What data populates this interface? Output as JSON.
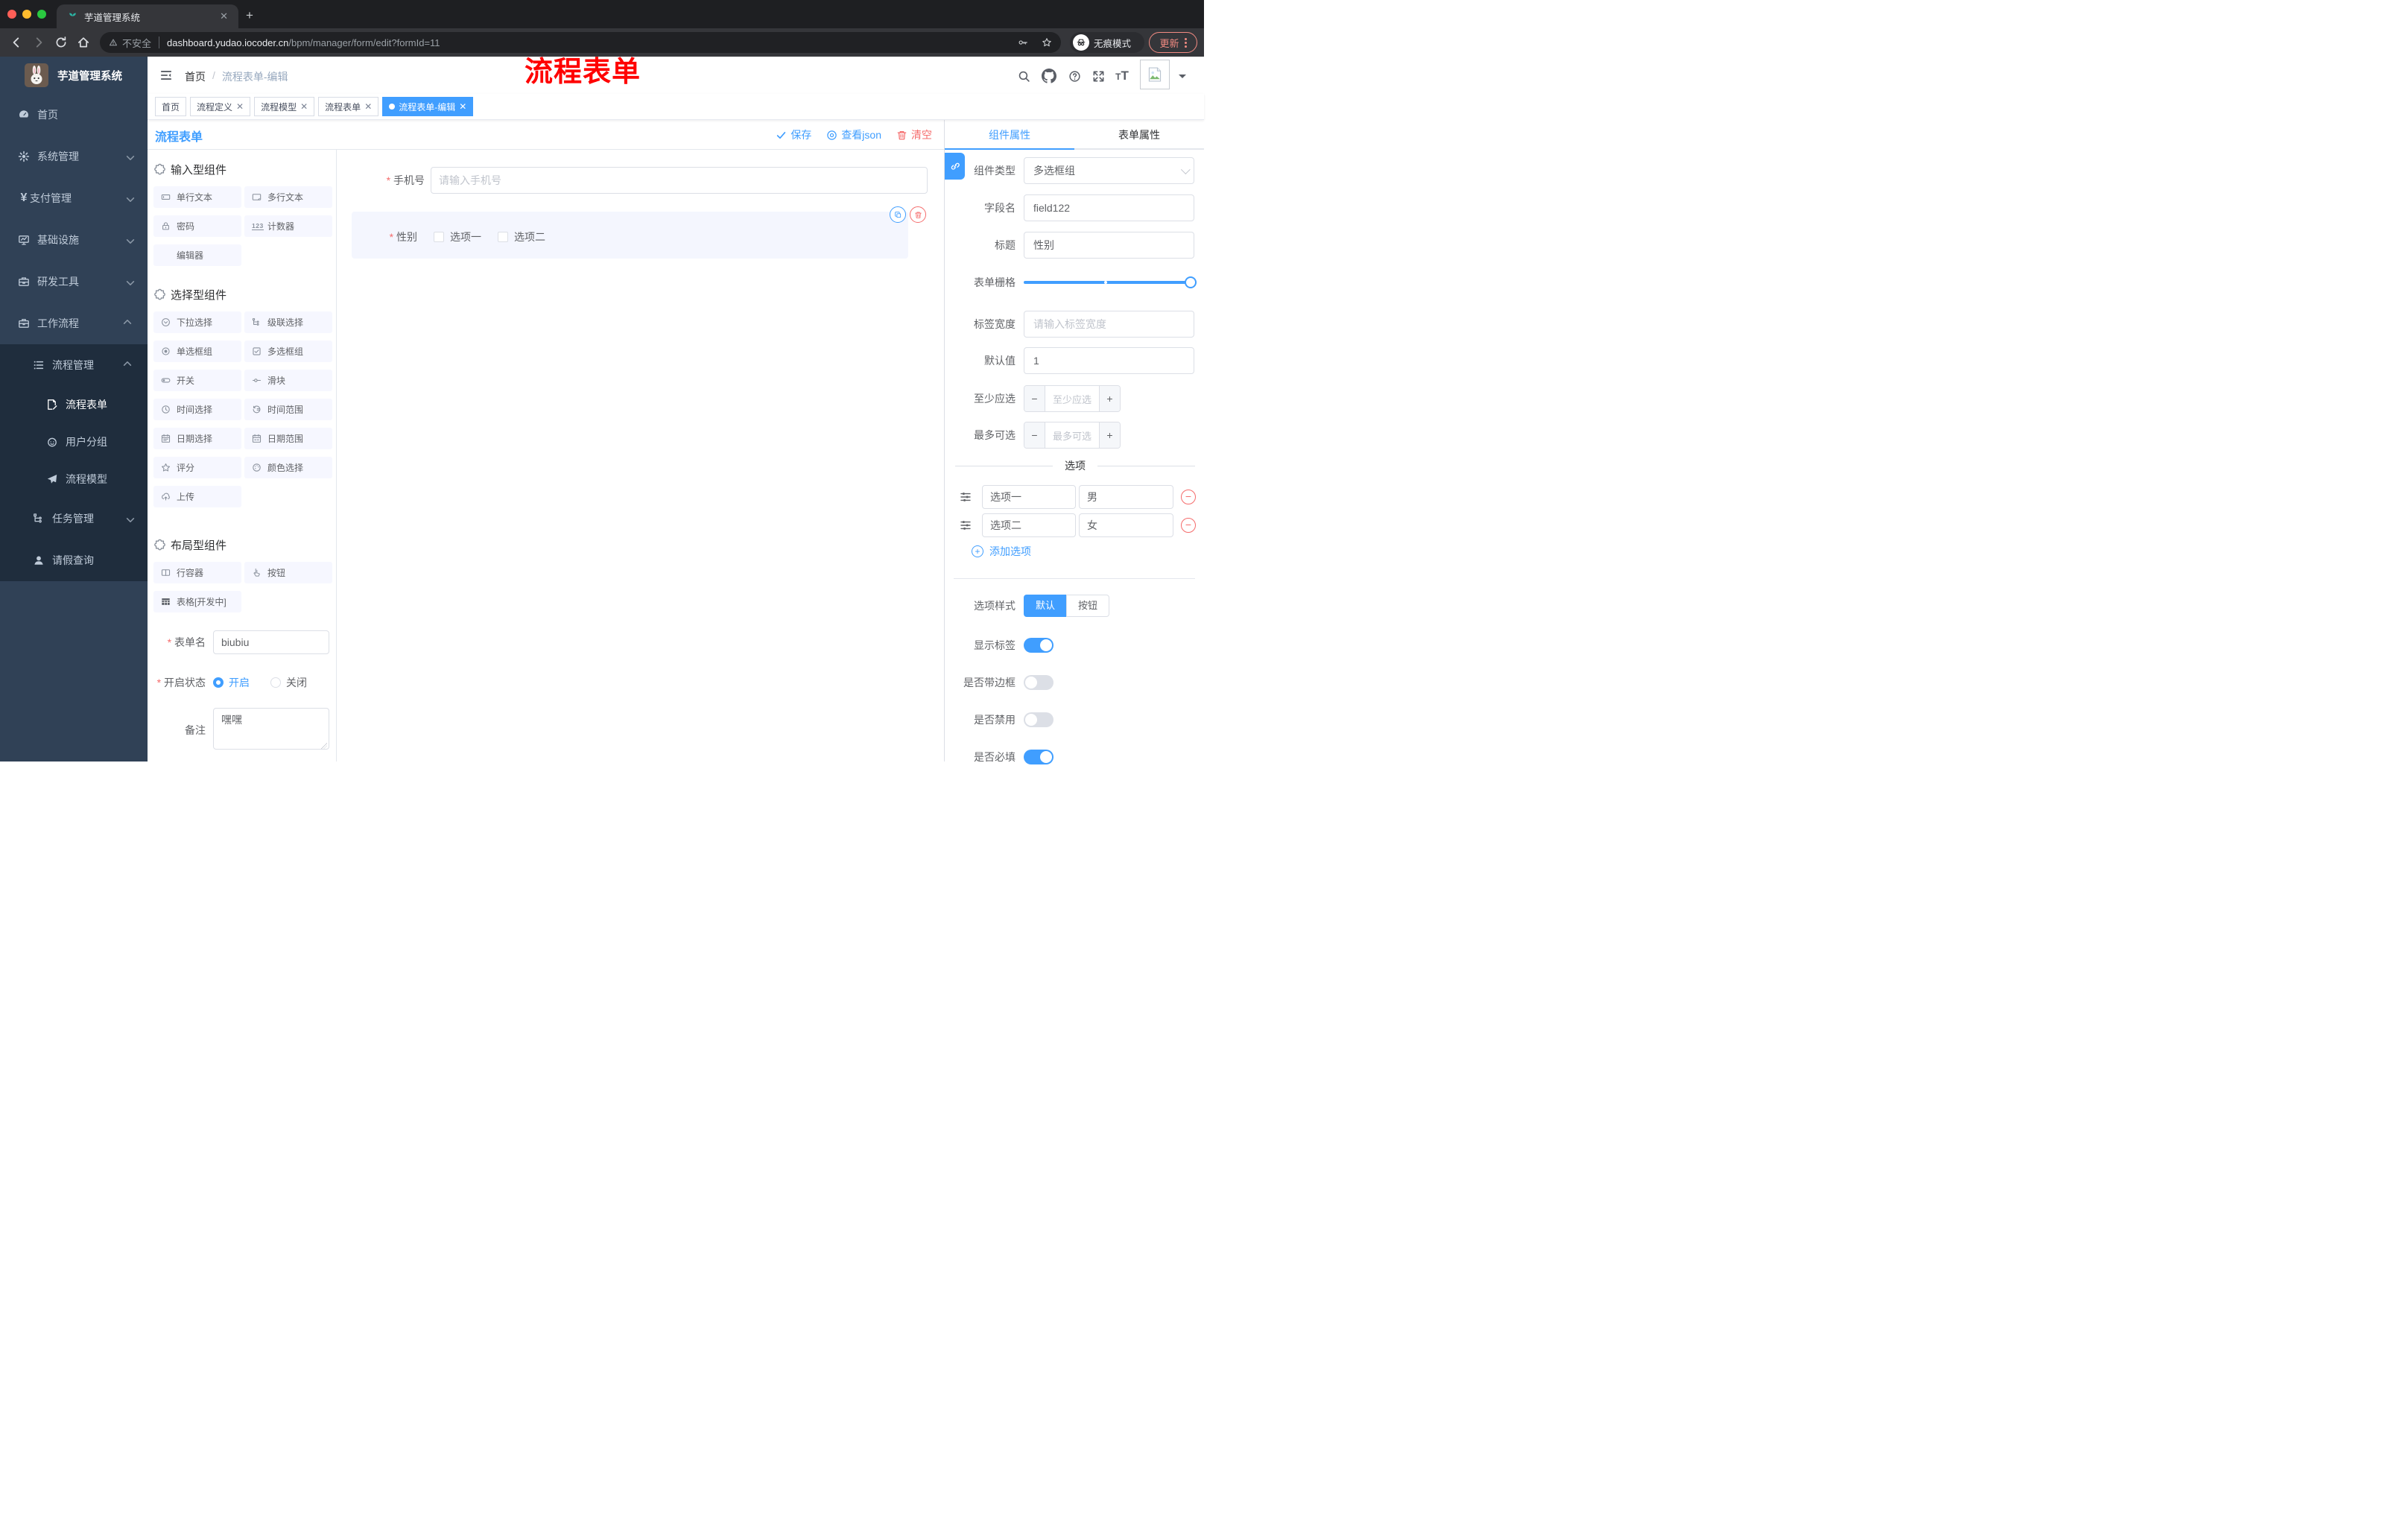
{
  "browser": {
    "tab_title": "芋道管理系统",
    "security": "不安全",
    "url_host": "dashboard.yudao.iocoder.cn",
    "url_path": "/bpm/manager/form/edit?formId=11",
    "incognito": "无痕模式",
    "update": "更新"
  },
  "sidebar": {
    "title": "芋道管理系统",
    "menu": [
      {
        "label": "首页",
        "icon": "dashboard",
        "level": 0
      },
      {
        "label": "系统管理",
        "icon": "gear",
        "level": 0,
        "chevron": "down"
      },
      {
        "label": "支付管理",
        "icon": "yen",
        "level": 0,
        "chevron": "down"
      },
      {
        "label": "基础设施",
        "icon": "monitor",
        "level": 0,
        "chevron": "down"
      },
      {
        "label": "研发工具",
        "icon": "toolbox",
        "level": 0,
        "chevron": "down"
      },
      {
        "label": "工作流程",
        "icon": "briefcase",
        "level": 0,
        "chevron": "up"
      },
      {
        "label": "流程管理",
        "icon": "listgear",
        "level": 1,
        "chevron": "up",
        "sub": true
      },
      {
        "label": "流程表单",
        "icon": "docedit",
        "level": 2,
        "sub": true,
        "active": true
      },
      {
        "label": "用户分组",
        "icon": "face",
        "level": 2,
        "sub": true
      },
      {
        "label": "流程模型",
        "icon": "plane",
        "level": 2,
        "sub": true
      },
      {
        "label": "任务管理",
        "icon": "tree",
        "level": 1,
        "chevron": "down",
        "sub": true
      },
      {
        "label": "请假查询",
        "icon": "user",
        "level": 1,
        "sub": true
      }
    ]
  },
  "header": {
    "breadcrumb_home": "首页",
    "breadcrumb_sep": "/",
    "breadcrumb_current": "流程表单-编辑",
    "annotation": "流程表单"
  },
  "tags": [
    {
      "label": "首页",
      "closable": false,
      "active": false
    },
    {
      "label": "流程定义",
      "closable": true,
      "active": false
    },
    {
      "label": "流程模型",
      "closable": true,
      "active": false
    },
    {
      "label": "流程表单",
      "closable": true,
      "active": false
    },
    {
      "label": "流程表单-编辑",
      "closable": true,
      "active": true
    }
  ],
  "designer": {
    "title": "流程表单",
    "save": "保存",
    "view_json": "查看json",
    "clear": "清空"
  },
  "components": {
    "sections": [
      {
        "title": "输入型组件",
        "items": [
          {
            "label": "单行文本",
            "icon": "input"
          },
          {
            "label": "多行文本",
            "icon": "textarea"
          },
          {
            "label": "密码",
            "icon": "lock"
          },
          {
            "label": "计数器",
            "icon": "num123"
          },
          {
            "label": "编辑器",
            "icon": "none"
          }
        ]
      },
      {
        "title": "选择型组件",
        "items": [
          {
            "label": "下拉选择",
            "icon": "select"
          },
          {
            "label": "级联选择",
            "icon": "cascade"
          },
          {
            "label": "单选框组",
            "icon": "radio"
          },
          {
            "label": "多选框组",
            "icon": "checkbox"
          },
          {
            "label": "开关",
            "icon": "switch"
          },
          {
            "label": "滑块",
            "icon": "slider"
          },
          {
            "label": "时间选择",
            "icon": "clock"
          },
          {
            "label": "时间范围",
            "icon": "timerange"
          },
          {
            "label": "日期选择",
            "icon": "calendar"
          },
          {
            "label": "日期范围",
            "icon": "calrange"
          },
          {
            "label": "评分",
            "icon": "star"
          },
          {
            "label": "颜色选择",
            "icon": "palette"
          },
          {
            "label": "上传",
            "icon": "upload"
          }
        ]
      },
      {
        "title": "布局型组件",
        "items": [
          {
            "label": "行容器",
            "icon": "columns"
          },
          {
            "label": "按钮",
            "icon": "pointer"
          },
          {
            "label": "表格[开发中]",
            "icon": "tablefill"
          }
        ]
      }
    ],
    "form": {
      "name_label": "表单名",
      "name_value": "biubiu",
      "status_label": "开启状态",
      "status_on": "开启",
      "status_off": "关闭",
      "remark_label": "备注",
      "remark_value": "嘿嘿"
    }
  },
  "canvas": {
    "phone_label": "手机号",
    "phone_placeholder": "请输入手机号",
    "gender_label": "性别",
    "gender_opt1": "选项一",
    "gender_opt2": "选项二"
  },
  "props": {
    "tab_component": "组件属性",
    "tab_form": "表单属性",
    "type_label": "组件类型",
    "type_value": "多选框组",
    "field_label": "字段名",
    "field_value": "field122",
    "title_label": "标题",
    "title_value": "性别",
    "grid_label": "表单栅格",
    "labelw_label": "标签宽度",
    "labelw_placeholder": "请输入标签宽度",
    "default_label": "默认值",
    "default_value": "1",
    "min_label": "至少应选",
    "min_placeholder": "至少应选",
    "max_label": "最多可选",
    "max_placeholder": "最多可选",
    "options_title": "选项",
    "option_rows": [
      {
        "name": "选项一",
        "value": "男"
      },
      {
        "name": "选项二",
        "value": "女"
      }
    ],
    "add_option": "添加选项",
    "style_label": "选项样式",
    "style_default": "默认",
    "style_button": "按钮",
    "switches": [
      {
        "label": "显示标签",
        "on": true
      },
      {
        "label": "是否带边框",
        "on": false
      },
      {
        "label": "是否禁用",
        "on": false
      },
      {
        "label": "是否必填",
        "on": true
      }
    ]
  },
  "colors": {
    "primary": "#409eff",
    "danger": "#f56c6c",
    "sidebar": "#304156",
    "submenu": "#1f2d3d",
    "annotation": "#ff0000"
  }
}
